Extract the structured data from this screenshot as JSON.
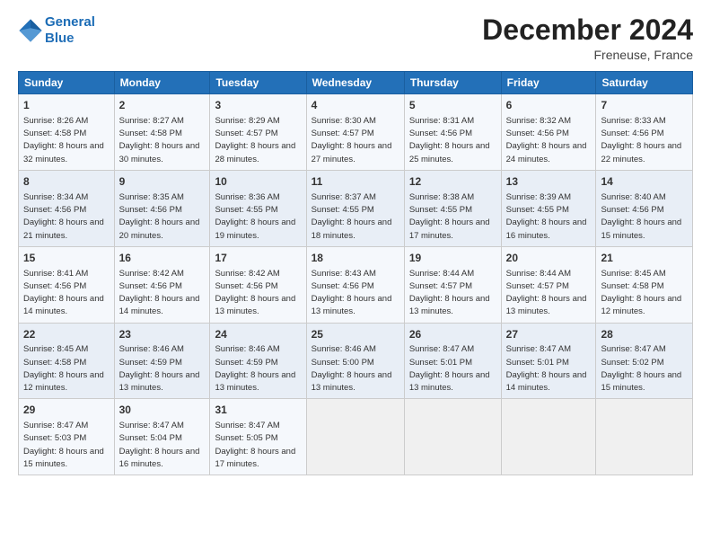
{
  "header": {
    "logo_line1": "General",
    "logo_line2": "Blue",
    "month_title": "December 2024",
    "location": "Freneuse, France"
  },
  "weekdays": [
    "Sunday",
    "Monday",
    "Tuesday",
    "Wednesday",
    "Thursday",
    "Friday",
    "Saturday"
  ],
  "weeks": [
    [
      {
        "day": "1",
        "sunrise": "8:26 AM",
        "sunset": "4:58 PM",
        "daylight": "8 hours and 32 minutes"
      },
      {
        "day": "2",
        "sunrise": "8:27 AM",
        "sunset": "4:58 PM",
        "daylight": "8 hours and 30 minutes"
      },
      {
        "day": "3",
        "sunrise": "8:29 AM",
        "sunset": "4:57 PM",
        "daylight": "8 hours and 28 minutes"
      },
      {
        "day": "4",
        "sunrise": "8:30 AM",
        "sunset": "4:57 PM",
        "daylight": "8 hours and 27 minutes"
      },
      {
        "day": "5",
        "sunrise": "8:31 AM",
        "sunset": "4:56 PM",
        "daylight": "8 hours and 25 minutes"
      },
      {
        "day": "6",
        "sunrise": "8:32 AM",
        "sunset": "4:56 PM",
        "daylight": "8 hours and 24 minutes"
      },
      {
        "day": "7",
        "sunrise": "8:33 AM",
        "sunset": "4:56 PM",
        "daylight": "8 hours and 22 minutes"
      }
    ],
    [
      {
        "day": "8",
        "sunrise": "8:34 AM",
        "sunset": "4:56 PM",
        "daylight": "8 hours and 21 minutes"
      },
      {
        "day": "9",
        "sunrise": "8:35 AM",
        "sunset": "4:56 PM",
        "daylight": "8 hours and 20 minutes"
      },
      {
        "day": "10",
        "sunrise": "8:36 AM",
        "sunset": "4:55 PM",
        "daylight": "8 hours and 19 minutes"
      },
      {
        "day": "11",
        "sunrise": "8:37 AM",
        "sunset": "4:55 PM",
        "daylight": "8 hours and 18 minutes"
      },
      {
        "day": "12",
        "sunrise": "8:38 AM",
        "sunset": "4:55 PM",
        "daylight": "8 hours and 17 minutes"
      },
      {
        "day": "13",
        "sunrise": "8:39 AM",
        "sunset": "4:55 PM",
        "daylight": "8 hours and 16 minutes"
      },
      {
        "day": "14",
        "sunrise": "8:40 AM",
        "sunset": "4:56 PM",
        "daylight": "8 hours and 15 minutes"
      }
    ],
    [
      {
        "day": "15",
        "sunrise": "8:41 AM",
        "sunset": "4:56 PM",
        "daylight": "8 hours and 14 minutes"
      },
      {
        "day": "16",
        "sunrise": "8:42 AM",
        "sunset": "4:56 PM",
        "daylight": "8 hours and 14 minutes"
      },
      {
        "day": "17",
        "sunrise": "8:42 AM",
        "sunset": "4:56 PM",
        "daylight": "8 hours and 13 minutes"
      },
      {
        "day": "18",
        "sunrise": "8:43 AM",
        "sunset": "4:56 PM",
        "daylight": "8 hours and 13 minutes"
      },
      {
        "day": "19",
        "sunrise": "8:44 AM",
        "sunset": "4:57 PM",
        "daylight": "8 hours and 13 minutes"
      },
      {
        "day": "20",
        "sunrise": "8:44 AM",
        "sunset": "4:57 PM",
        "daylight": "8 hours and 13 minutes"
      },
      {
        "day": "21",
        "sunrise": "8:45 AM",
        "sunset": "4:58 PM",
        "daylight": "8 hours and 12 minutes"
      }
    ],
    [
      {
        "day": "22",
        "sunrise": "8:45 AM",
        "sunset": "4:58 PM",
        "daylight": "8 hours and 12 minutes"
      },
      {
        "day": "23",
        "sunrise": "8:46 AM",
        "sunset": "4:59 PM",
        "daylight": "8 hours and 13 minutes"
      },
      {
        "day": "24",
        "sunrise": "8:46 AM",
        "sunset": "4:59 PM",
        "daylight": "8 hours and 13 minutes"
      },
      {
        "day": "25",
        "sunrise": "8:46 AM",
        "sunset": "5:00 PM",
        "daylight": "8 hours and 13 minutes"
      },
      {
        "day": "26",
        "sunrise": "8:47 AM",
        "sunset": "5:01 PM",
        "daylight": "8 hours and 13 minutes"
      },
      {
        "day": "27",
        "sunrise": "8:47 AM",
        "sunset": "5:01 PM",
        "daylight": "8 hours and 14 minutes"
      },
      {
        "day": "28",
        "sunrise": "8:47 AM",
        "sunset": "5:02 PM",
        "daylight": "8 hours and 15 minutes"
      }
    ],
    [
      {
        "day": "29",
        "sunrise": "8:47 AM",
        "sunset": "5:03 PM",
        "daylight": "8 hours and 15 minutes"
      },
      {
        "day": "30",
        "sunrise": "8:47 AM",
        "sunset": "5:04 PM",
        "daylight": "8 hours and 16 minutes"
      },
      {
        "day": "31",
        "sunrise": "8:47 AM",
        "sunset": "5:05 PM",
        "daylight": "8 hours and 17 minutes"
      },
      null,
      null,
      null,
      null
    ]
  ]
}
